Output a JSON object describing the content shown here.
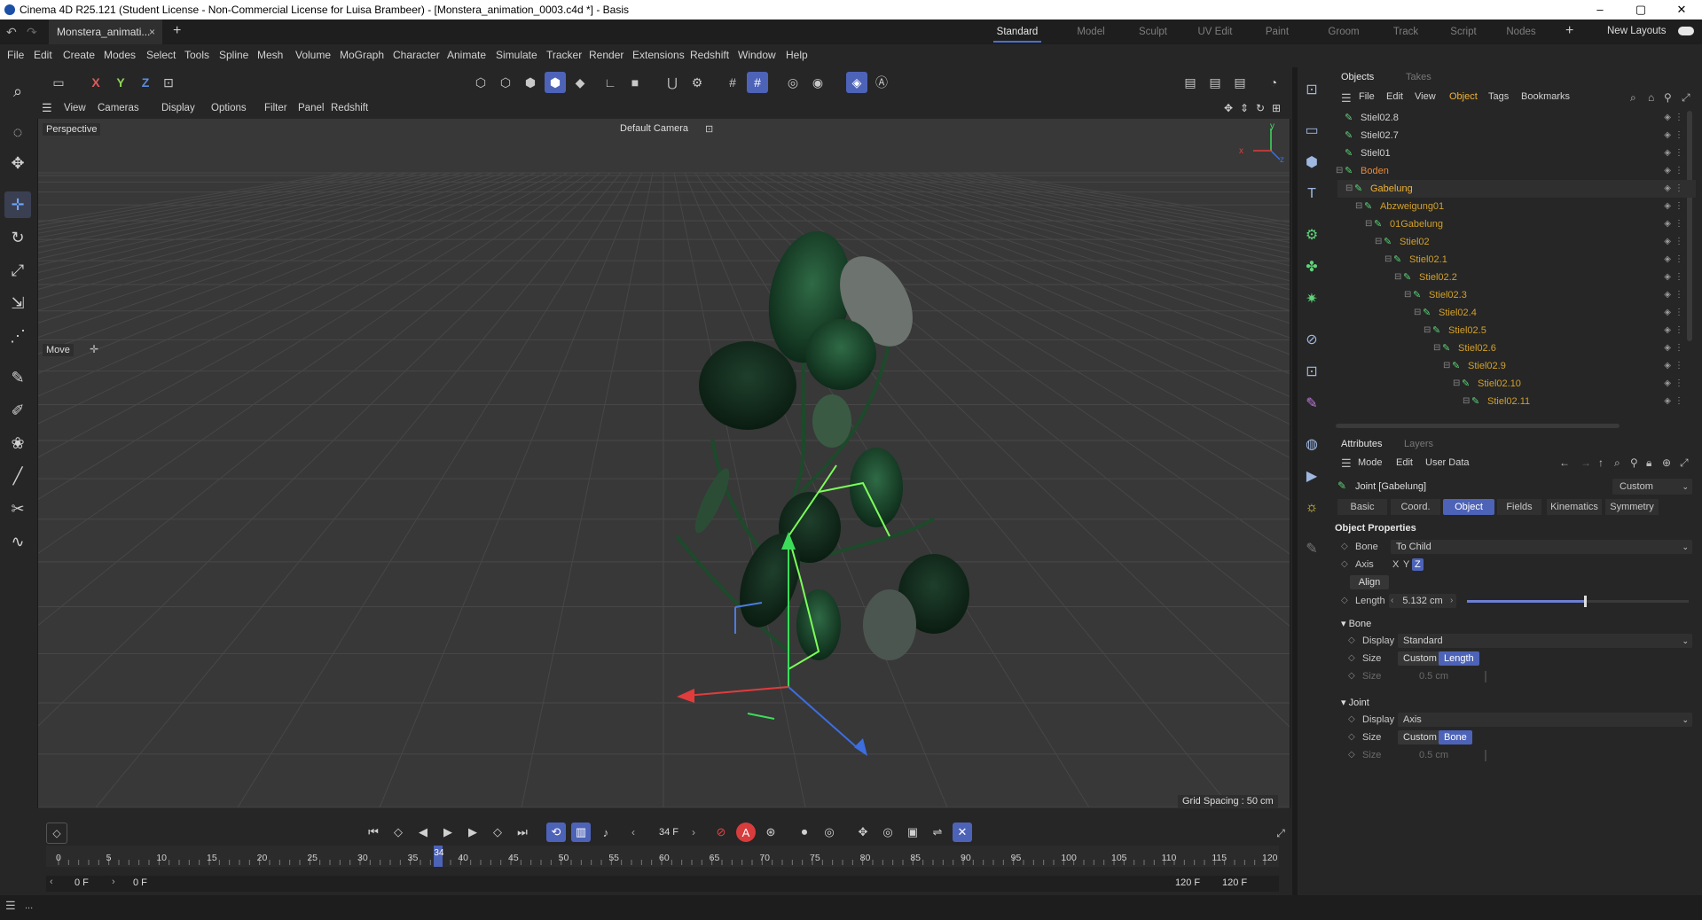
{
  "window": {
    "title": "Cinema 4D R25.121 (Student License - Non-Commercial License for Luisa Brambeer) - [Monstera_animation_0003.c4d *] - Basis"
  },
  "doc_tab": {
    "label": "Monstera_animati...",
    "close": "×",
    "add": "+"
  },
  "layouts": {
    "items": [
      "Standard",
      "Model",
      "Sculpt",
      "UV Edit",
      "Paint",
      "Groom",
      "Track",
      "Script",
      "Nodes"
    ],
    "add": "+",
    "new_layouts": "New Layouts"
  },
  "menu": [
    "File",
    "Edit",
    "Create",
    "Modes",
    "Select",
    "Tools",
    "Spline",
    "Mesh",
    "Volume",
    "MoGraph",
    "Character",
    "Animate",
    "Simulate",
    "Tracker",
    "Render",
    "Extensions",
    "Redshift",
    "Window",
    "Help"
  ],
  "axis_buttons": [
    "X",
    "Y",
    "Z"
  ],
  "viewport_menu": [
    "View",
    "Cameras",
    "Display",
    "Options",
    "Filter",
    "Panel",
    "Redshift"
  ],
  "viewport": {
    "projection": "Perspective",
    "camera": "Default Camera",
    "tool_hud": "Move",
    "grid_spacing": "Grid Spacing : 50 cm",
    "gizmo_x": "x",
    "gizmo_y": "y",
    "gizmo_z": "z"
  },
  "timeline": {
    "current_frame": "34 F",
    "start_field": "0 F",
    "start_sub": "0 F",
    "end_field": "120 F",
    "end_sub": "120 F",
    "ticks": [
      "0",
      "5",
      "10",
      "15",
      "20",
      "25",
      "30",
      "35",
      "40",
      "45",
      "50",
      "55",
      "60",
      "65",
      "70",
      "75",
      "80",
      "85",
      "90",
      "95",
      "100",
      "105",
      "110",
      "115",
      "120"
    ],
    "playhead_label": "34",
    "playhead_frame": 34
  },
  "status": {
    "text": "..."
  },
  "objects_panel": {
    "tabs": [
      "Objects",
      "Takes"
    ],
    "menu": [
      "File",
      "Edit",
      "View",
      "Object",
      "Tags",
      "Bookmarks"
    ],
    "rows": [
      {
        "name": "Stiel02.8",
        "indent": 0,
        "color": "#cfcfcf"
      },
      {
        "name": "Stiel02.7",
        "indent": 0,
        "color": "#cfcfcf"
      },
      {
        "name": "Stiel01",
        "indent": 0,
        "color": "#cfcfcf"
      },
      {
        "name": "Boden",
        "indent": 0,
        "color": "#e88a3a"
      },
      {
        "name": "Gabelung",
        "indent": 1,
        "color": "#f0b233"
      },
      {
        "name": "Abzweigung01",
        "indent": 2,
        "color": "#d2a02a"
      },
      {
        "name": "01Gabelung",
        "indent": 3,
        "color": "#d2a02a"
      },
      {
        "name": "Stiel02",
        "indent": 4,
        "color": "#d2a02a"
      },
      {
        "name": "Stiel02.1",
        "indent": 5,
        "color": "#d2a02a"
      },
      {
        "name": "Stiel02.2",
        "indent": 6,
        "color": "#d2a02a"
      },
      {
        "name": "Stiel02.3",
        "indent": 7,
        "color": "#d2a02a"
      },
      {
        "name": "Stiel02.4",
        "indent": 8,
        "color": "#d2a02a"
      },
      {
        "name": "Stiel02.5",
        "indent": 9,
        "color": "#d2a02a"
      },
      {
        "name": "Stiel02.6",
        "indent": 10,
        "color": "#d2a02a"
      },
      {
        "name": "Stiel02.9",
        "indent": 11,
        "color": "#d2a02a"
      },
      {
        "name": "Stiel02.10",
        "indent": 12,
        "color": "#d2a02a"
      },
      {
        "name": "Stiel02.11",
        "indent": 13,
        "color": "#d2a02a"
      }
    ]
  },
  "attributes_panel": {
    "tabs": [
      "Attributes",
      "Layers"
    ],
    "menu": [
      "Mode",
      "Edit",
      "User Data"
    ],
    "object_name": "Joint [Gabelung]",
    "mode_select": "Custom",
    "sub_tabs": [
      "Basic",
      "Coord.",
      "Object",
      "Fields",
      "Kinematics",
      "Symmetry"
    ],
    "active_sub_tab": "Object",
    "section_title": "Object Properties",
    "bone_label": "Bone",
    "bone_value": "To Child",
    "axis_label": "Axis",
    "axis_values": [
      "X",
      "Y",
      "Z"
    ],
    "align_label": "Align",
    "length_label": "Length",
    "length_value": "5.132 cm",
    "bone_section": "Bone",
    "bone_display_label": "Display",
    "bone_display_value": "Standard",
    "bone_size_label": "Size",
    "bone_size_options": [
      "Custom",
      "Length"
    ],
    "bone_size2_label": "Size",
    "bone_size2_value": "0.5 cm",
    "joint_section": "Joint",
    "joint_display_label": "Display",
    "joint_display_value": "Axis",
    "joint_size_label": "Size",
    "joint_size_options": [
      "Custom",
      "Bone"
    ],
    "joint_size2_label": "Size",
    "joint_size2_value": "0.5 cm"
  }
}
